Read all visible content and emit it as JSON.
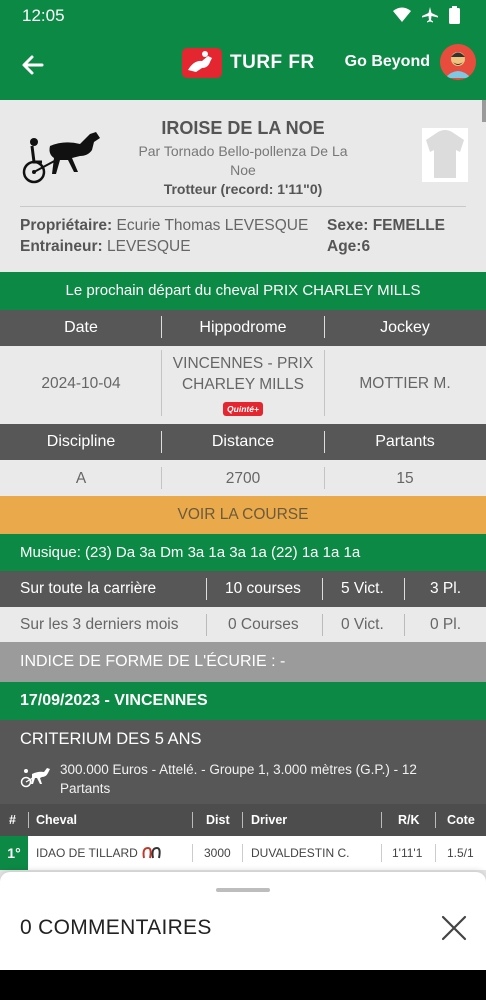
{
  "status_bar": {
    "time": "12:05"
  },
  "app_bar": {
    "logo_text": "TURF FR",
    "user_name": "Go Beyond"
  },
  "horse": {
    "name": "IROISE DE LA NOE",
    "parents": "Par Tornado Bello-pollenza De La Noe",
    "type_record": "Trotteur (record: 1'11\"0)",
    "owner_label": "Propriétaire:",
    "owner_value": "Ecurie Thomas LEVESQUE",
    "trainer_label": "Entraineur:",
    "trainer_value": "LEVESQUE",
    "sex_label": "Sexe:",
    "sex_value": "FEMELLE",
    "age_label": "Age:",
    "age_value": "6"
  },
  "next_race": {
    "banner": "Le prochain départ du cheval PRIX CHARLEY MILLS",
    "headers1": [
      "Date",
      "Hippodrome",
      "Jockey"
    ],
    "date": "2024-10-04",
    "hippodrome": "VINCENNES - PRIX CHARLEY MILLS",
    "badge": "Quinté+",
    "jockey": "MOTTIER M.",
    "headers2": [
      "Discipline",
      "Distance",
      "Partants"
    ],
    "discipline": "A",
    "distance": "2700",
    "partants": "15",
    "voir_button": "VOIR LA COURSE"
  },
  "musique": "Musique: (23) Da 3a Dm 3a 1a 3a 1a (22) 1a 1a 1a",
  "stats": [
    {
      "label": "Sur toute la carrière",
      "courses": "10 courses",
      "victoires": "5 Vict.",
      "places": "3 Pl."
    },
    {
      "label": "Sur les 3 derniers mois",
      "courses": "0 Courses",
      "victoires": "0 Vict.",
      "places": "0 Pl."
    }
  ],
  "indice": "INDICE DE FORME DE L'ÉCURIE : -",
  "last_race": {
    "date_place": "17/09/2023 - VINCENNES",
    "title": "CRITERIUM DES 5 ANS",
    "description": "300.000 Euros - Attelé. - Groupe 1, 3.000 mètres (G.P.) - 12 Partants",
    "columns": [
      "#",
      "Cheval",
      "Dist",
      "Driver",
      "R/K",
      "Cote"
    ],
    "rows": [
      {
        "rank": "1°",
        "horse": "IDAO DE TILLARD",
        "dist": "3000",
        "driver": "DUVALDESTIN C.",
        "rk": "1'11'1",
        "cote": "1.5/1"
      }
    ]
  },
  "comments": {
    "title": "0 COMMENTAIRES"
  },
  "colors": {
    "primary_green": "#0c8a45",
    "dark_gray": "#575757",
    "orange_button": "#eaaa4b",
    "red_badge": "#e3262f"
  }
}
